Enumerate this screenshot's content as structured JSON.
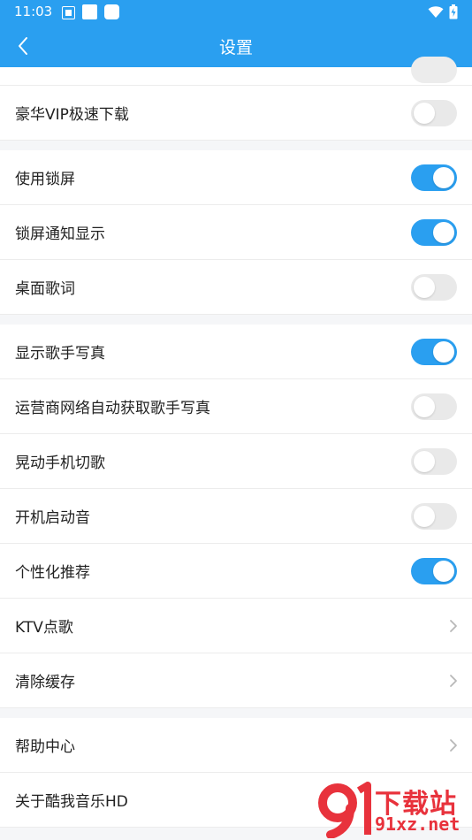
{
  "status_bar": {
    "time": "11:03"
  },
  "app_bar": {
    "title": "设置"
  },
  "sections": [
    {
      "rows": [
        {
          "label": "豪华VIP极速下载",
          "control": "toggle",
          "on": false
        }
      ]
    },
    {
      "rows": [
        {
          "label": "使用锁屏",
          "control": "toggle",
          "on": true
        },
        {
          "label": "锁屏通知显示",
          "control": "toggle",
          "on": true
        },
        {
          "label": "桌面歌词",
          "control": "toggle",
          "on": false
        }
      ]
    },
    {
      "rows": [
        {
          "label": "显示歌手写真",
          "control": "toggle",
          "on": true
        },
        {
          "label": "运营商网络自动获取歌手写真",
          "control": "toggle",
          "on": false
        },
        {
          "label": "晃动手机切歌",
          "control": "toggle",
          "on": false
        },
        {
          "label": "开机启动音",
          "control": "toggle",
          "on": false
        },
        {
          "label": "个性化推荐",
          "control": "toggle",
          "on": true
        },
        {
          "label": "KTV点歌",
          "control": "chevron"
        },
        {
          "label": "清除缓存",
          "control": "chevron"
        }
      ]
    },
    {
      "rows": [
        {
          "label": "帮助中心",
          "control": "chevron"
        },
        {
          "label": "关于酷我音乐HD",
          "control": "chevron"
        }
      ]
    }
  ],
  "watermark": {
    "top": "下载站",
    "bottom": "91xz.net"
  },
  "colors": {
    "accent": "#2a9ff0",
    "toggle_off": "#e9e9e9",
    "watermark": "#e8323c"
  }
}
